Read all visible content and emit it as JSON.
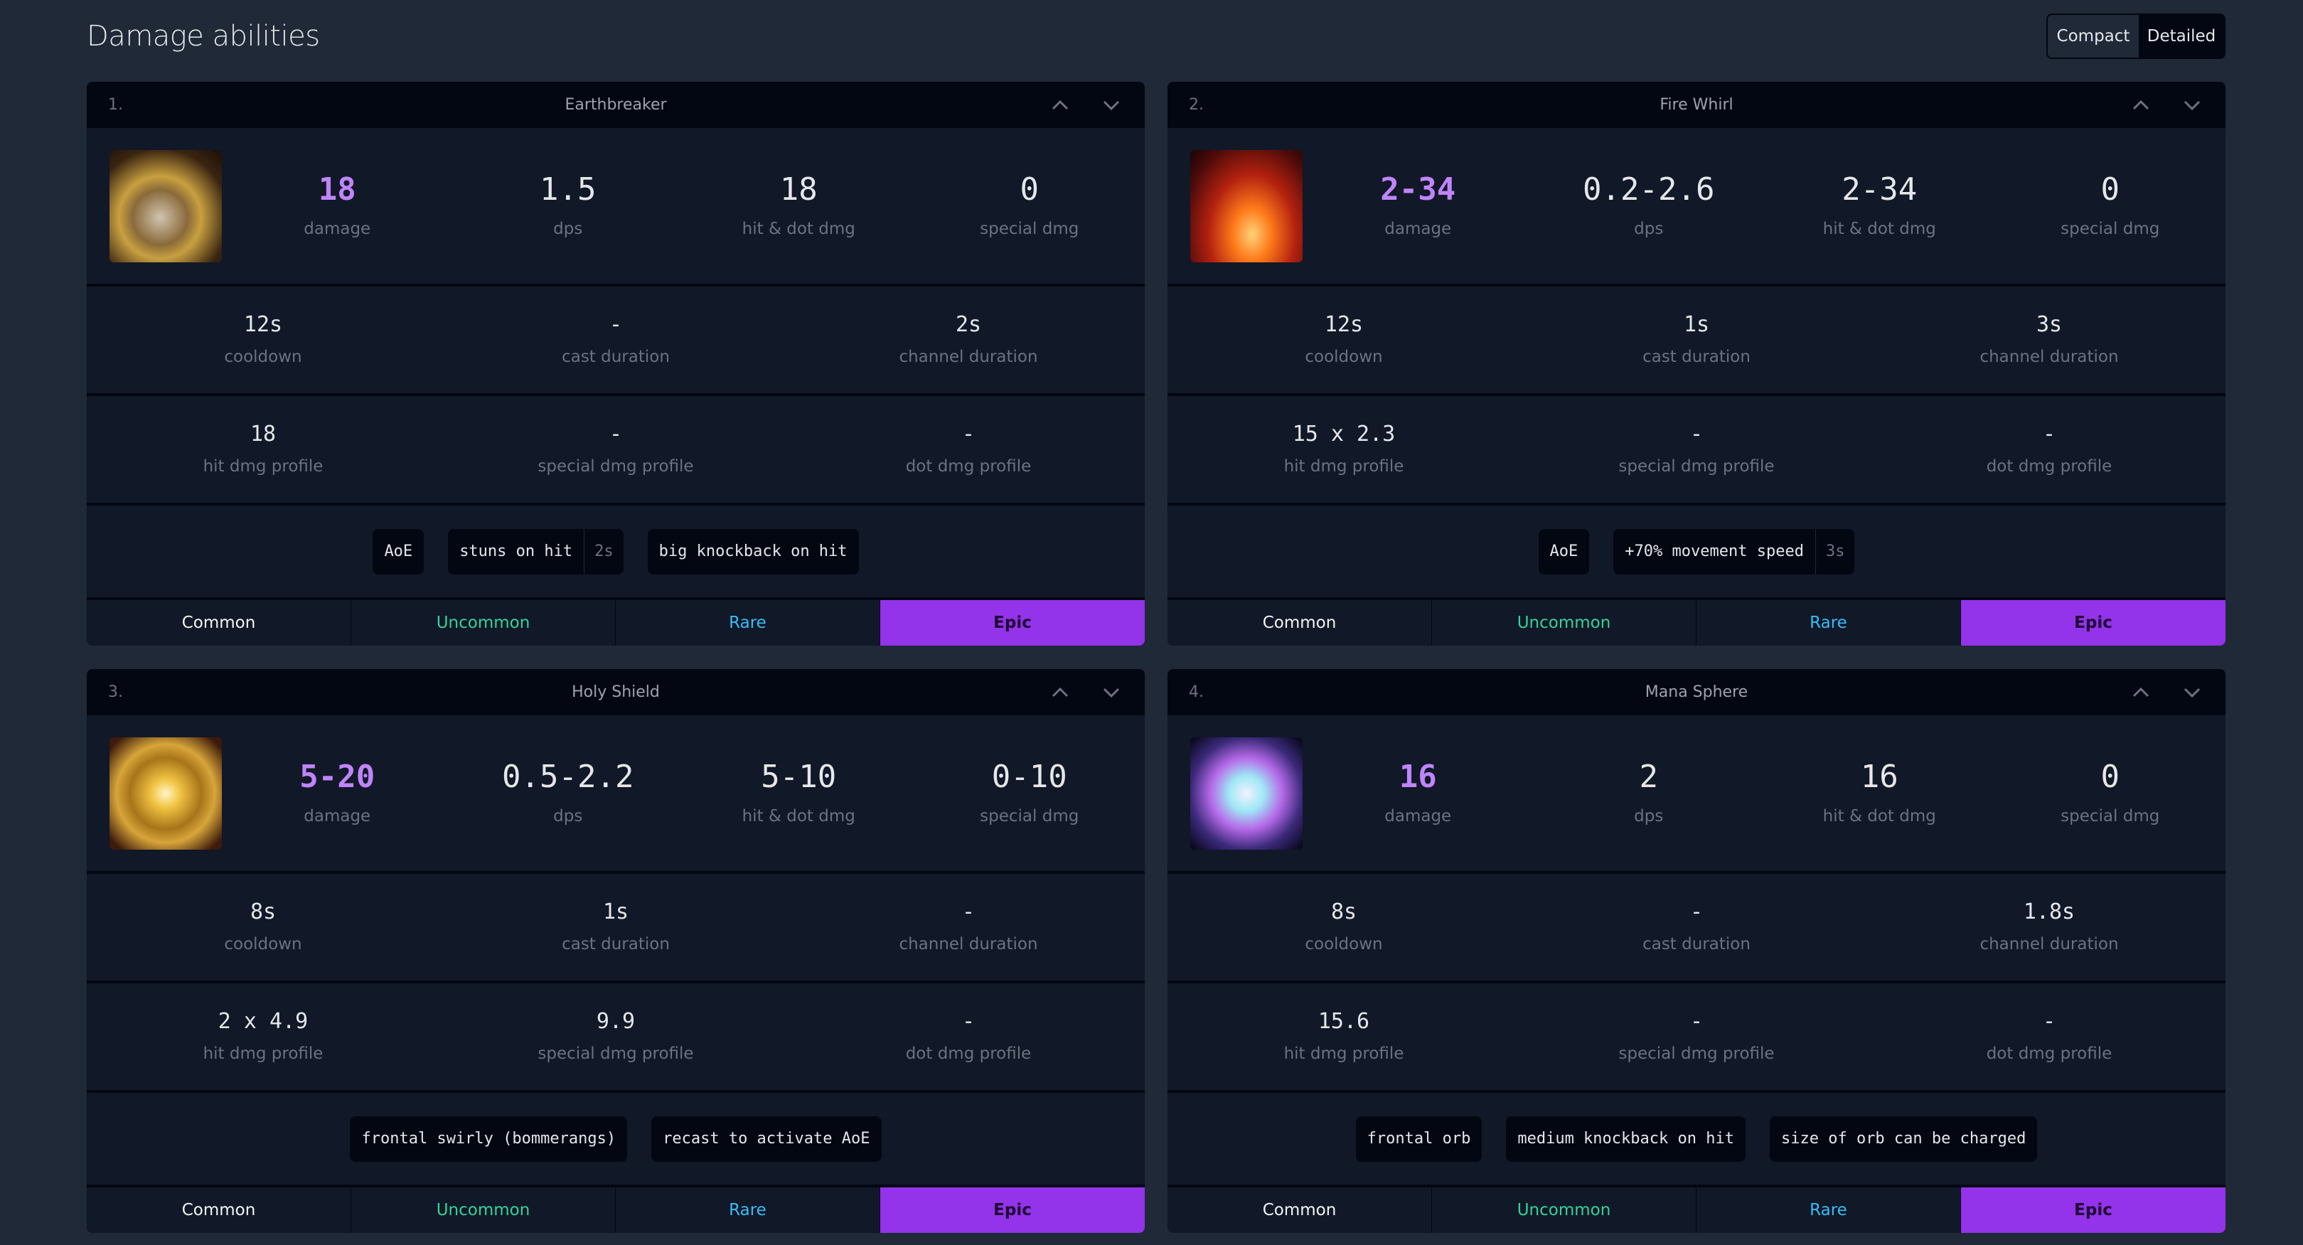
{
  "page": {
    "title": "Damage abilities",
    "view_toggle": {
      "compact": "Compact",
      "detailed": "Detailed",
      "selected": "Compact"
    }
  },
  "colors": {
    "accent_damage": "#c084fc",
    "common": "#f3f4f6",
    "uncommon": "#34d399",
    "rare": "#38bdf8",
    "epic_bg": "#9333ea",
    "epic_text": "#1e0533"
  },
  "labels": {
    "damage": "damage",
    "dps": "dps",
    "hit_dot": "hit & dot dmg",
    "special": "special dmg",
    "cooldown": "cooldown",
    "cast": "cast duration",
    "channel": "channel duration",
    "hit_profile": "hit dmg profile",
    "special_profile": "special dmg profile",
    "dot_profile": "dot dmg profile"
  },
  "rarities": [
    "Common",
    "Uncommon",
    "Rare",
    "Epic"
  ],
  "abilities": [
    {
      "index": "1.",
      "name": "Earthbreaker",
      "icon": "earthbreaker-icon",
      "damage": "18",
      "dps": "1.5",
      "hit_dot": "18",
      "special": "0",
      "cooldown": "12s",
      "cast": "-",
      "channel": "2s",
      "hit_profile": "18",
      "special_profile": "-",
      "dot_profile": "-",
      "tags": [
        {
          "text": "AoE"
        },
        {
          "text": "stuns on hit",
          "duration": "2s"
        },
        {
          "text": "big knockback on hit"
        }
      ],
      "selected_rarity": "Epic"
    },
    {
      "index": "2.",
      "name": "Fire Whirl",
      "icon": "fire-whirl-icon",
      "damage": "2-34",
      "dps": "0.2-2.6",
      "hit_dot": "2-34",
      "special": "0",
      "cooldown": "12s",
      "cast": "1s",
      "channel": "3s",
      "hit_profile": "15 x 2.3",
      "special_profile": "-",
      "dot_profile": "-",
      "tags": [
        {
          "text": "AoE"
        },
        {
          "text": "+70% movement speed",
          "duration": "3s"
        }
      ],
      "selected_rarity": "Epic"
    },
    {
      "index": "3.",
      "name": "Holy Shield",
      "icon": "holy-shield-icon",
      "damage": "5-20",
      "dps": "0.5-2.2",
      "hit_dot": "5-10",
      "special": "0-10",
      "cooldown": "8s",
      "cast": "1s",
      "channel": "-",
      "hit_profile": "2 x 4.9",
      "special_profile": "9.9",
      "dot_profile": "-",
      "tags": [
        {
          "text": "frontal swirly (bommerangs)"
        },
        {
          "text": "recast to activate AoE"
        }
      ],
      "selected_rarity": "Epic"
    },
    {
      "index": "4.",
      "name": "Mana Sphere",
      "icon": "mana-sphere-icon",
      "damage": "16",
      "dps": "2",
      "hit_dot": "16",
      "special": "0",
      "cooldown": "8s",
      "cast": "-",
      "channel": "1.8s",
      "hit_profile": "15.6",
      "special_profile": "-",
      "dot_profile": "-",
      "tags": [
        {
          "text": "frontal orb"
        },
        {
          "text": "medium knockback on hit"
        },
        {
          "text": "size of orb can be charged"
        }
      ],
      "selected_rarity": "Epic"
    }
  ]
}
